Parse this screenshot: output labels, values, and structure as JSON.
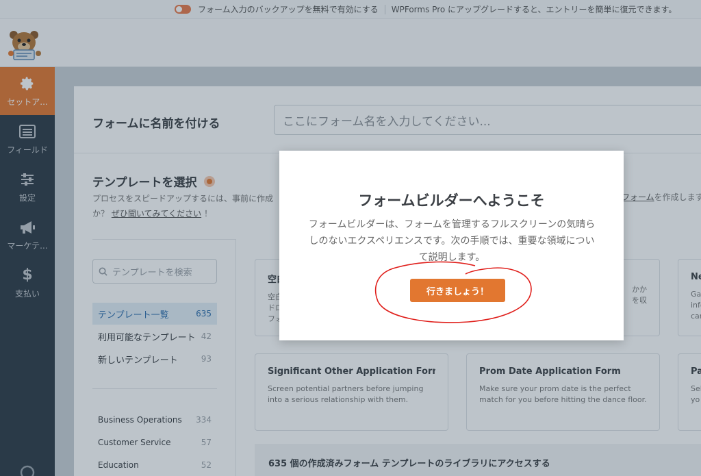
{
  "notice_bar": {
    "backup_text": "フォーム入力のバックアップを無料で有効にする",
    "upgrade_text": "WPForms Pro にアップグレードすると、エントリーを簡単に復元できます。"
  },
  "sidebar": {
    "items": [
      {
        "label": "セットア...",
        "icon": "gear-icon"
      },
      {
        "label": "フィールド",
        "icon": "list-icon"
      },
      {
        "label": "設定",
        "icon": "sliders-icon"
      },
      {
        "label": "マーケテ...",
        "icon": "megaphone-icon"
      },
      {
        "label": "支払い",
        "icon": "dollar-icon"
      }
    ]
  },
  "form_name": {
    "label": "フォームに名前を付ける",
    "placeholder": "ここにフォーム名を入力してください..."
  },
  "templates": {
    "title": "テンプレートを選択",
    "desc_line1": "プロセスをスピードアップするには、事前に作成",
    "desc_line2_prefix": "か？",
    "desc_link": "ぜひ聞いてみてください",
    "desc_line2_suffix": "！",
    "desc_right_link": "フォーム",
    "desc_right_suffix": "を作成します",
    "search_placeholder": "テンプレートを検索",
    "categories": [
      {
        "label": "テンプレート一覧",
        "count": "635"
      },
      {
        "label": "利用可能なテンプレート",
        "count": "42"
      },
      {
        "label": "新しいテンプレート",
        "count": "93"
      }
    ],
    "industries": [
      {
        "label": "Business Operations",
        "count": "334"
      },
      {
        "label": "Customer Service",
        "count": "57"
      },
      {
        "label": "Education",
        "count": "52"
      }
    ],
    "cards_row1": [
      {
        "title": "空白",
        "desc": "空白\nドロ\nフォ"
      },
      {
        "title": "",
        "desc": "かか\nを収"
      },
      {
        "title": "Ne",
        "desc": "Ga\ninfo\ncan"
      }
    ],
    "cards_row2": [
      {
        "title": "Significant Other Application Form",
        "desc": "Screen potential partners before jumping into a serious relationship with them."
      },
      {
        "title": "Prom Date Application Form",
        "desc": "Make sure your prom date is the perfect match for you before hitting the dance floor."
      },
      {
        "title": "Pa",
        "desc": "Sel\nyo"
      }
    ],
    "library_banner": "635 個の作成済みフォーム テンプレートのライブラリにアクセスする"
  },
  "modal": {
    "title": "フォームビルダーへようこそ",
    "text": "フォームビルダーは、フォームを管理するフルスクリーンの気晴らしのないエクスペリエンスです。次の手順では、重要な領域について説明します。",
    "button": "行きましょう！"
  },
  "colors": {
    "accent": "#e27730",
    "sidebar_bg": "#2d3a46",
    "selected_category_bg": "#e3eef7",
    "annotation_red": "#e0201c"
  }
}
